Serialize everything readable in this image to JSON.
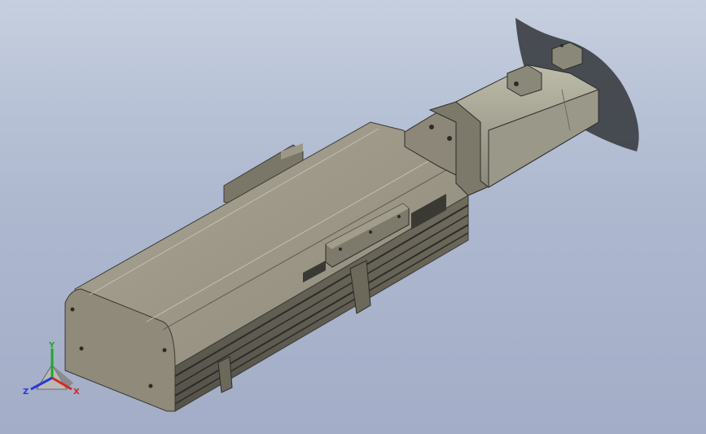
{
  "app": {
    "view_background_top": "#c5cfdf",
    "view_background_bottom": "#a3adc7"
  },
  "model": {
    "body_color": "#8f8a7a",
    "body_dark": "#6e6a5c",
    "motor_color": "#99988a",
    "shadow_color": "#2e3035"
  },
  "triad": {
    "x_label": "X",
    "y_label": "Y",
    "z_label": "Z",
    "x_color": "#d42a1e",
    "y_color": "#1ea82a",
    "z_color": "#2a3ad4"
  }
}
